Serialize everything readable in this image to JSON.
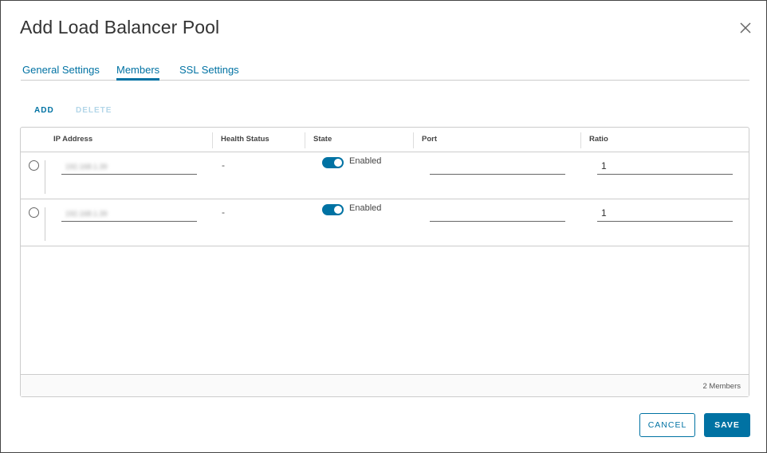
{
  "modal": {
    "title": "Add Load Balancer Pool"
  },
  "tabs": [
    {
      "label": "General Settings",
      "active": false
    },
    {
      "label": "Members",
      "active": true
    },
    {
      "label": "SSL Settings",
      "active": false
    }
  ],
  "actions": {
    "add_label": "ADD",
    "delete_label": "DELETE"
  },
  "grid": {
    "columns": [
      "IP Address",
      "Health Status",
      "State",
      "Port",
      "Ratio"
    ],
    "rows": [
      {
        "ip": "192.168.1.39",
        "health": "-",
        "state": "Enabled",
        "port": "",
        "ratio": "1"
      },
      {
        "ip": "192.168.1.39",
        "health": "-",
        "state": "Enabled",
        "port": "",
        "ratio": "1"
      }
    ],
    "footer_count": "2 Members"
  },
  "buttons": {
    "cancel_label": "CANCEL",
    "save_label": "SAVE"
  },
  "colors": {
    "accent": "#0072a3",
    "disabled_text": "#b3d6e8",
    "border": "#cccccc"
  },
  "icons": {
    "close": "close-icon"
  }
}
